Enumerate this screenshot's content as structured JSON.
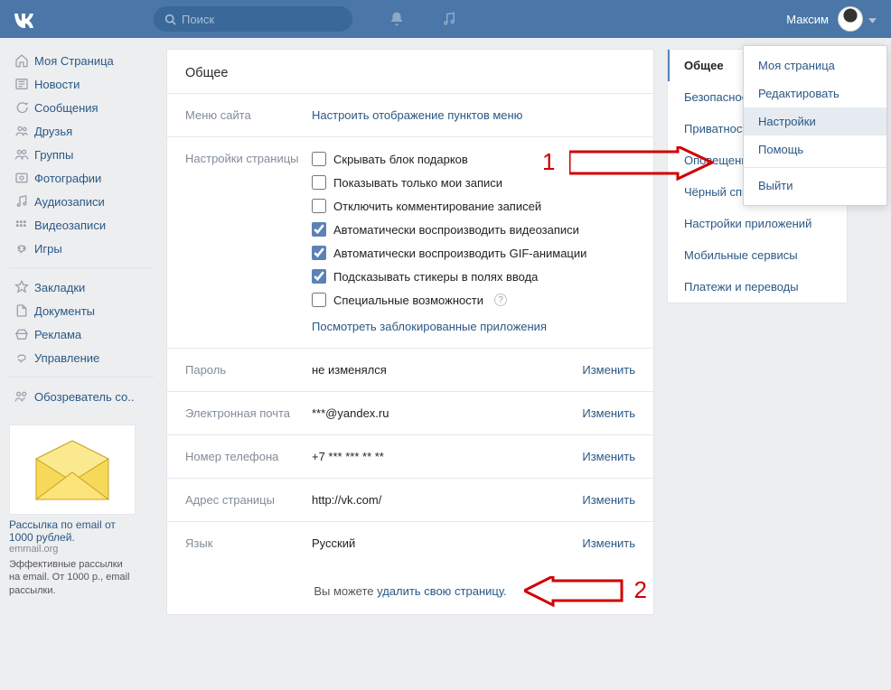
{
  "topbar": {
    "search_placeholder": "Поиск",
    "user_name": "Максим"
  },
  "leftnav": {
    "items": [
      {
        "label": "Моя Страница"
      },
      {
        "label": "Новости"
      },
      {
        "label": "Сообщения"
      },
      {
        "label": "Друзья"
      },
      {
        "label": "Группы"
      },
      {
        "label": "Фотографии"
      },
      {
        "label": "Аудиозаписи"
      },
      {
        "label": "Видеозаписи"
      },
      {
        "label": "Игры"
      }
    ],
    "items2": [
      {
        "label": "Закладки"
      },
      {
        "label": "Документы"
      },
      {
        "label": "Реклама"
      },
      {
        "label": "Управление"
      }
    ],
    "items3": [
      {
        "label": "Обозреватель со.."
      }
    ]
  },
  "ad": {
    "title": "Рассылка по email от 1000 рублей.",
    "domain": "emmail.org",
    "desc": "Эффективные рассылки на email. От 1000 р., email рассылки."
  },
  "settings": {
    "heading": "Общее",
    "menu_label": "Меню сайта",
    "menu_link": "Настроить отображение пунктов меню",
    "page_settings_label": "Настройки страницы",
    "checks": [
      {
        "label": "Скрывать блок подарков",
        "checked": false
      },
      {
        "label": "Показывать только мои записи",
        "checked": false
      },
      {
        "label": "Отключить комментирование записей",
        "checked": false
      },
      {
        "label": "Автоматически воспроизводить видеозаписи",
        "checked": true
      },
      {
        "label": "Автоматически воспроизводить GIF-анимации",
        "checked": true
      },
      {
        "label": "Подсказывать стикеры в полях ввода",
        "checked": true
      },
      {
        "label": "Специальные возможности",
        "checked": false,
        "help": true
      }
    ],
    "blocked_link": "Посмотреть заблокированные приложения",
    "rows": [
      {
        "key": "password",
        "label": "Пароль",
        "value": "не изменялся",
        "change": "Изменить"
      },
      {
        "key": "email",
        "label": "Электронная почта",
        "value": "***@yandex.ru",
        "change": "Изменить"
      },
      {
        "key": "phone",
        "label": "Номер телефона",
        "value": "+7 *** *** ** **",
        "change": "Изменить"
      },
      {
        "key": "url",
        "label": "Адрес страницы",
        "value": "http://vk.com/",
        "change": "Изменить"
      },
      {
        "key": "lang",
        "label": "Язык",
        "value": "Русский",
        "change": "Изменить"
      }
    ],
    "footer_pre": "Вы можете ",
    "footer_link": "удалить свою страницу."
  },
  "right_tabs": [
    {
      "label": "Общее",
      "active": true
    },
    {
      "label": "Безопасность"
    },
    {
      "label": "Приватность"
    },
    {
      "label": "Оповещения"
    },
    {
      "label": "Чёрный список"
    },
    {
      "label": "Настройки приложений"
    },
    {
      "label": "Мобильные сервисы"
    },
    {
      "label": "Платежи и переводы"
    }
  ],
  "dropdown": [
    {
      "label": "Моя страница"
    },
    {
      "label": "Редактировать"
    },
    {
      "label": "Настройки",
      "active": true
    },
    {
      "label": "Помощь"
    }
  ],
  "dropdown_exit": "Выйти",
  "annotations": {
    "num1": "1",
    "num2": "2"
  }
}
